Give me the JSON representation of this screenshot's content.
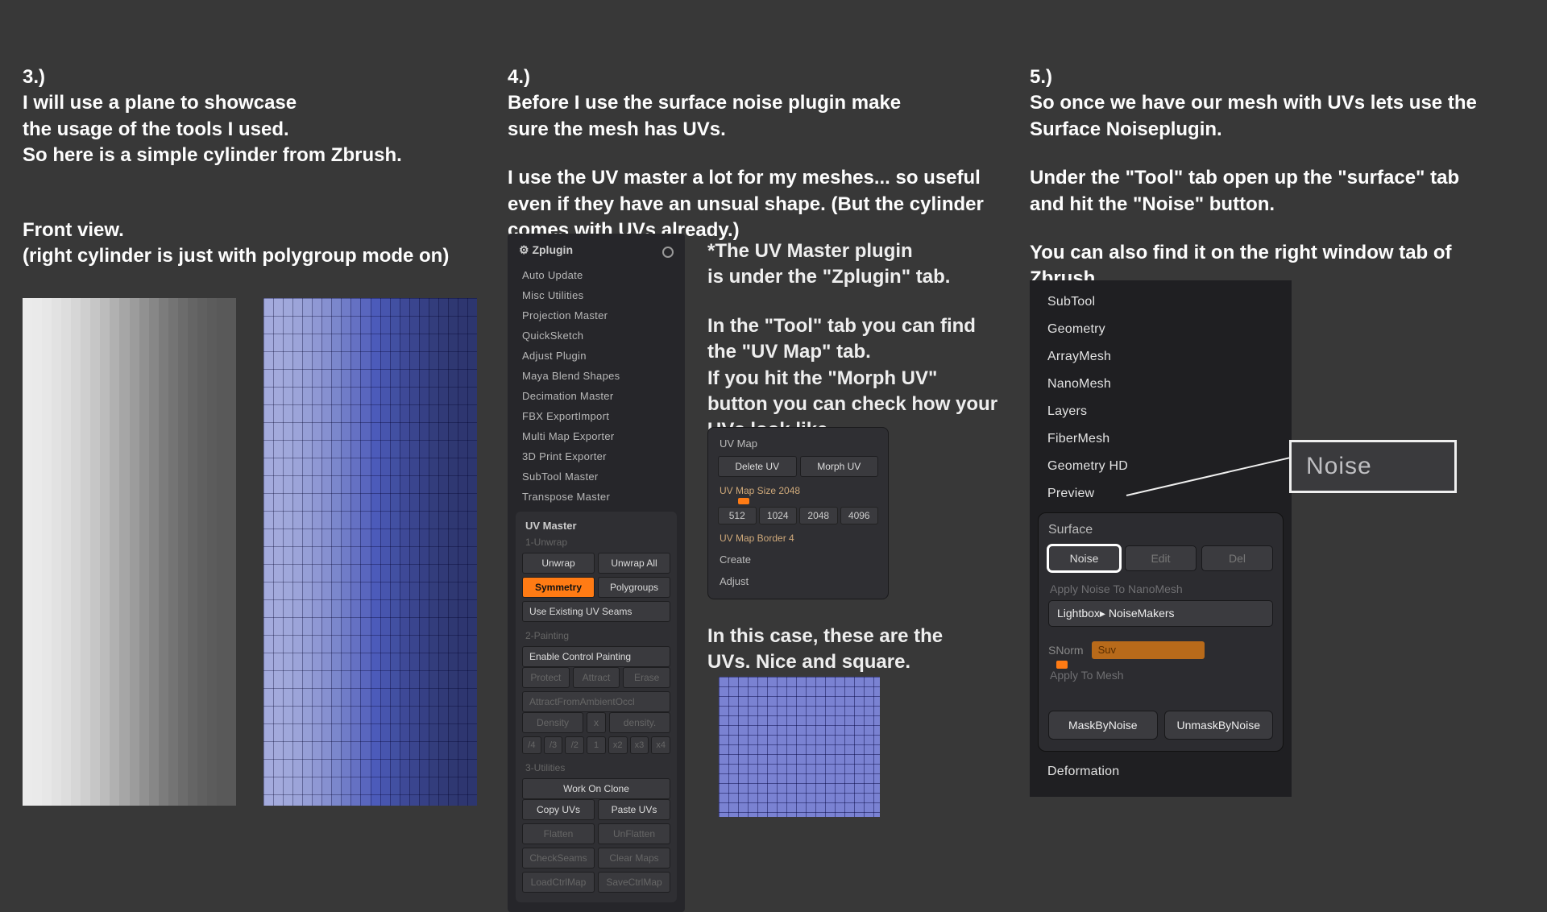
{
  "col1": {
    "num": "3.)",
    "l1": "I will use a plane to showcase",
    "l2": "the usage of the tools I used.",
    "l3": "So here is a simple cylinder from Zbrush.",
    "front": "Front view.",
    "frontsub": "(right cylinder is just with polygroup mode on)"
  },
  "col2": {
    "num": "4.)",
    "l1": "Before I use the surface noise plugin make",
    "l2": "sure the mesh has UVs.",
    "l3": "I use the UV master a lot for my meshes... so useful",
    "l4": "even if they have an unsual shape. (But the cylinder",
    "l5": "comes with UVs already.)",
    "side1": "*The UV Master plugin",
    "side2": "is under the \"Zplugin\" tab.",
    "side3": "In the \"Tool\" tab you can find",
    "side4": "the \"UV Map\" tab.",
    "side5": "If you hit the \"Morph UV\"",
    "side6": "button you can check how your",
    "side7": "UVs look like.",
    "uvnote1": "In this case, these are the",
    "uvnote2": "UVs. Nice and square."
  },
  "zplugin": {
    "title": "Zplugin",
    "items": [
      "Auto Update",
      "Misc Utilities",
      "Projection Master",
      "QuickSketch",
      "Adjust Plugin",
      "Maya Blend Shapes",
      "Decimation Master",
      "FBX ExportImport",
      "Multi Map Exporter",
      "3D Print Exporter",
      "SubTool Master",
      "Transpose Master"
    ],
    "uvmaster": "UV Master",
    "unwrapGroup": "1-Unwrap",
    "unwrap": "Unwrap",
    "unwrapAll": "Unwrap All",
    "symmetry": "Symmetry",
    "polygroups": "Polygroups",
    "useExisting": "Use Existing UV Seams",
    "paintGroup": "2-Painting",
    "enablePaint": "Enable Control Painting",
    "protect": "Protect",
    "attract": "Attract",
    "erase": "Erase",
    "attrAO": "AttractFromAmbientOccl",
    "density": "Density",
    "x": "x",
    "densityDot": "density.",
    "d4": "/4",
    "d3": "/3",
    "d2": "/2",
    "d1": "1",
    "x2": "x2",
    "x3": "x3",
    "x4": "x4",
    "utilGroup": "3-Utilities",
    "workClone": "Work On Clone",
    "copyUV": "Copy UVs",
    "pasteUV": "Paste UVs",
    "flatten": "Flatten",
    "unflatten": "UnFlatten",
    "checkSeams": "CheckSeams",
    "clearMaps": "Clear Maps",
    "loadCtrl": "LoadCtrlMap",
    "saveCtrl": "SaveCtrlMap"
  },
  "uvmap": {
    "title": "UV Map",
    "deleteUV": "Delete UV",
    "morphUV": "Morph UV",
    "sizeLbl": "UV Map Size 2048",
    "s512": "512",
    "s1024": "1024",
    "s2048": "2048",
    "s4096": "4096",
    "borderLbl": "UV Map Border 4",
    "create": "Create",
    "adjust": "Adjust"
  },
  "col3": {
    "num": "5.)",
    "l1": "So once we have our mesh with UVs lets use the",
    "l2": "Surface Noiseplugin.",
    "l3": "Under the \"Tool\" tab open up the \"surface\" tab",
    "l4": "and hit the \"Noise\" button.",
    "l5": "You can also find it on the right window tab of",
    "l6": "Zbrush."
  },
  "tool": {
    "items": [
      "SubTool",
      "Geometry",
      "ArrayMesh",
      "NanoMesh",
      "Layers",
      "FiberMesh",
      "Geometry HD",
      "Preview"
    ],
    "surface": "Surface",
    "noise": "Noise",
    "edit": "Edit",
    "del": "Del",
    "applyNano": "Apply Noise To NanoMesh",
    "lightbox": "Lightbox▸ NoiseMakers",
    "snorm": "SNorm",
    "suv": "Suv",
    "applyMesh": "Apply To Mesh",
    "mask": "MaskByNoise",
    "unmask": "UnmaskByNoise",
    "deformation": "Deformation"
  },
  "callout": {
    "noise": "Noise"
  }
}
